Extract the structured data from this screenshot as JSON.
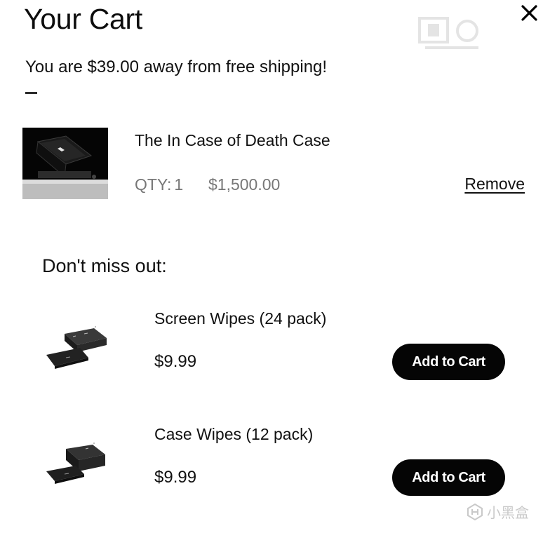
{
  "cart": {
    "title": "Your Cart",
    "close_icon": "close-icon",
    "shipping_message": "You are $39.00 away from free shipping!",
    "free_shipping_progress": 0.03
  },
  "line_item": {
    "name": "The In Case of Death Case",
    "qty_label": "QTY:",
    "qty_value": "1",
    "price": "$1,500.00",
    "remove_label": "Remove",
    "image_icon": "tablet-case-product-image"
  },
  "upsell": {
    "heading": "Don't miss out:",
    "items": [
      {
        "name": "Screen Wipes (24 pack)",
        "price": "$9.99",
        "button_label": "Add to Cart",
        "image_icon": "screen-wipes-product-image"
      },
      {
        "name": "Case Wipes (12 pack)",
        "price": "$9.99",
        "button_label": "Add to Cart",
        "image_icon": "case-wipes-product-image"
      }
    ]
  },
  "watermark": {
    "text": "小黑盒"
  },
  "colors": {
    "button_bg": "#050505",
    "button_text": "#ffffff",
    "muted_text": "#777777",
    "text": "#111111"
  }
}
